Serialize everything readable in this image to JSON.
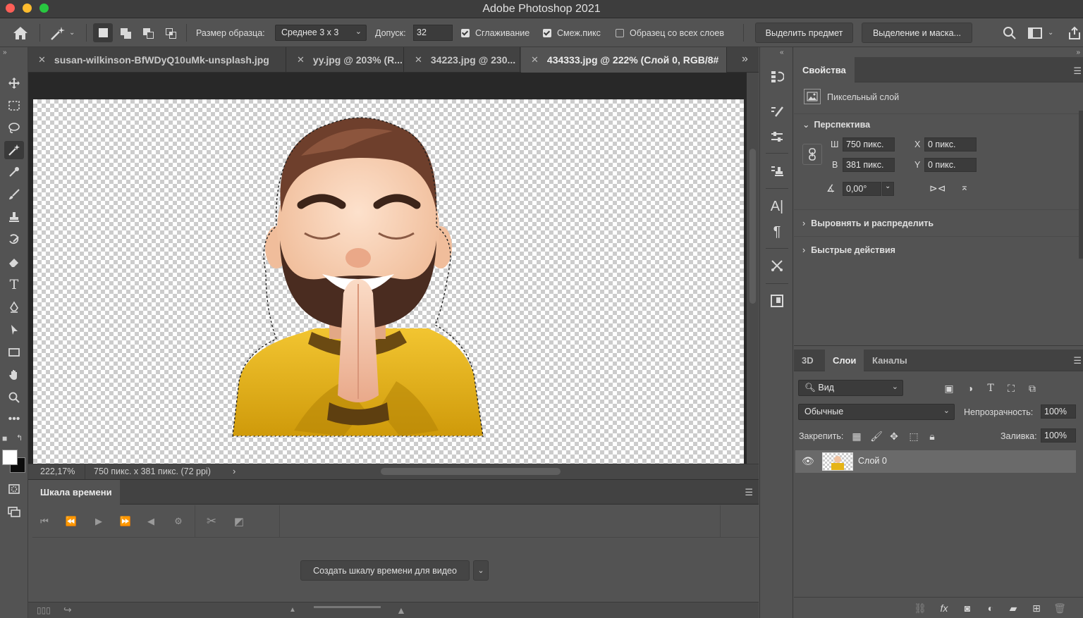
{
  "app": {
    "title": "Adobe Photoshop 2021"
  },
  "options": {
    "sample_size_label": "Размер образца:",
    "sample_size_value": "Среднее 3 x 3",
    "tolerance_label": "Допуск:",
    "tolerance_value": "32",
    "antialias_label": "Сглаживание",
    "contiguous_label": "Смеж.пикс",
    "all_layers_label": "Образец со всех слоев",
    "select_subject": "Выделить предмет",
    "select_mask": "Выделение и маска..."
  },
  "tabs": [
    {
      "label": "susan-wilkinson-BfWDyQ10uMk-unsplash.jpg"
    },
    {
      "label": "yy.jpg @ 203% (R..."
    },
    {
      "label": "34223.jpg @ 230..."
    },
    {
      "label": "434333.jpg @ 222% (Слой 0, RGB/8#"
    }
  ],
  "status": {
    "zoom": "222,17%",
    "size": "750 пикс. x 381 пикс. (72 ppi)"
  },
  "timeline": {
    "tab": "Шкала времени",
    "create_button": "Создать шкалу времени для видео"
  },
  "properties": {
    "tab": "Свойства",
    "layer_type": "Пиксельный слой",
    "perspective": "Перспектива",
    "w_label": "Ш",
    "w_value": "750 пикс.",
    "h_label": "В",
    "h_value": "381 пикс.",
    "x_label": "X",
    "x_value": "0 пикс.",
    "y_label": "Y",
    "y_value": "0 пикс.",
    "angle_value": "0,00°",
    "align_section": "Выровнять и распределить",
    "quick_actions": "Быстрые действия"
  },
  "layers": {
    "tabs": [
      "3D",
      "Слои",
      "Каналы"
    ],
    "filter_value": "Вид",
    "blend_mode": "Обычные",
    "opacity_label": "Непрозрачность:",
    "opacity_value": "100%",
    "lock_label": "Закрепить:",
    "fill_label": "Заливка:",
    "fill_value": "100%",
    "items": [
      {
        "name": "Слой 0"
      }
    ]
  },
  "colors": {
    "accent_selection": "#ffffff",
    "shirt": "#e6b417"
  }
}
